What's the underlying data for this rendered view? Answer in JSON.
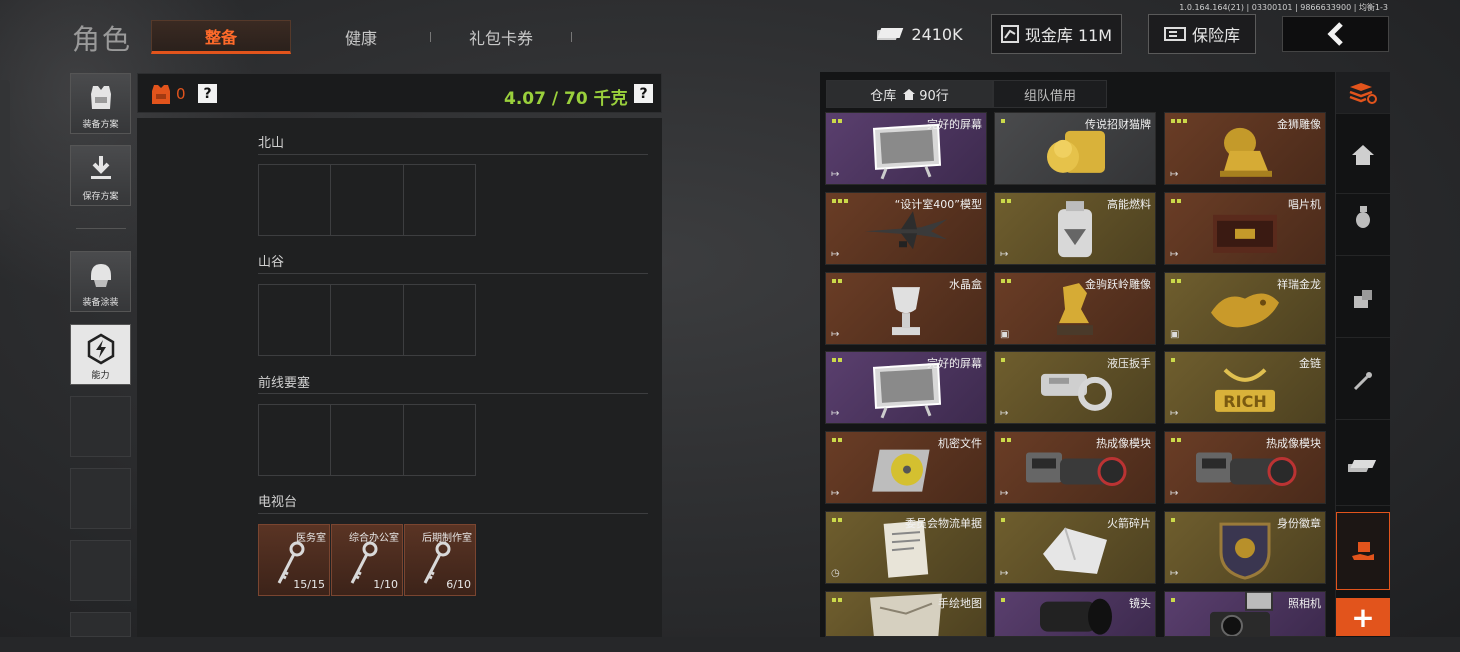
{
  "build_info": "1.0.164.164(21) | 03300101 | 9866633900 | 均衡1-3",
  "header": {
    "title": "角色",
    "tabs": [
      {
        "label": "整备"
      },
      {
        "label": "健康"
      },
      {
        "label": "礼包卡券"
      }
    ],
    "cash": "2410K",
    "cash_vault": "现金库 11M",
    "safe": "保险库"
  },
  "sidebar": {
    "items": [
      {
        "label": "装备方案"
      },
      {
        "label": "保存方案"
      },
      {
        "label": "装备涂装"
      },
      {
        "label": "能力"
      }
    ]
  },
  "loadout": {
    "armor_count": "0",
    "weight": "4.07 / 70 千克"
  },
  "maps": [
    {
      "label": "北山"
    },
    {
      "label": "山谷"
    },
    {
      "label": "前线要塞"
    },
    {
      "label": "电视台"
    }
  ],
  "keys": [
    {
      "name": "医务室",
      "count": "15/15"
    },
    {
      "name": "综合办公室",
      "count": "1/10"
    },
    {
      "name": "后期制作室",
      "count": "6/10"
    }
  ],
  "storage": {
    "tab_warehouse": "仓库",
    "tab_warehouse_count": "90行",
    "tab_team": "组队借用",
    "items": [
      {
        "name": "完好的屏幕",
        "rarity": "purple",
        "dots": 2,
        "corner": "↦",
        "icon": "screen-icon"
      },
      {
        "name": "传说招财猫牌",
        "rarity": "gray",
        "dots": 1,
        "corner": "",
        "icon": "gold-cat-icon"
      },
      {
        "name": "金狮雕像",
        "rarity": "brown",
        "dots": 3,
        "corner": "↦",
        "icon": "lion-statue-icon"
      },
      {
        "name": "“设计室400”模型",
        "rarity": "brown",
        "dots": 3,
        "corner": "↦",
        "icon": "jet-model-icon"
      },
      {
        "name": "高能燃料",
        "rarity": "olive",
        "dots": 2,
        "corner": "↦",
        "icon": "fuel-tank-icon"
      },
      {
        "name": "唱片机",
        "rarity": "brown",
        "dots": 2,
        "corner": "↦",
        "icon": "record-player-icon"
      },
      {
        "name": "水晶盒",
        "rarity": "brown",
        "dots": 2,
        "corner": "↦",
        "icon": "trophy-icon"
      },
      {
        "name": "金驹跃岭雕像",
        "rarity": "brown",
        "dots": 2,
        "corner": "▣",
        "icon": "horse-statue-icon"
      },
      {
        "name": "祥瑞金龙",
        "rarity": "olive",
        "dots": 2,
        "corner": "▣",
        "icon": "dragon-icon"
      },
      {
        "name": "完好的屏幕",
        "rarity": "purple",
        "dots": 2,
        "corner": "↦",
        "icon": "screen-icon"
      },
      {
        "name": "液压扳手",
        "rarity": "olive",
        "dots": 1,
        "corner": "↦",
        "icon": "wrench-icon"
      },
      {
        "name": "金链",
        "rarity": "olive",
        "dots": 1,
        "corner": "↦",
        "icon": "gold-chain-icon"
      },
      {
        "name": "机密文件",
        "rarity": "brown",
        "dots": 2,
        "corner": "↦",
        "icon": "disc-icon"
      },
      {
        "name": "热成像模块",
        "rarity": "brown",
        "dots": 2,
        "corner": "↦",
        "icon": "thermal-module-icon"
      },
      {
        "name": "热成像模块",
        "rarity": "brown",
        "dots": 2,
        "corner": "↦",
        "icon": "thermal-module-icon"
      },
      {
        "name": "委员会物流单据",
        "rarity": "olive",
        "dots": 2,
        "corner": "◷",
        "icon": "document-icon"
      },
      {
        "name": "火箭碎片",
        "rarity": "olive",
        "dots": 1,
        "corner": "↦",
        "icon": "rocket-fragment-icon"
      },
      {
        "name": "身份徽章",
        "rarity": "olive",
        "dots": 1,
        "corner": "↦",
        "icon": "badge-icon"
      },
      {
        "name": "手绘地图",
        "rarity": "olive",
        "dots": 2,
        "corner": "",
        "icon": "map-icon"
      },
      {
        "name": "镜头",
        "rarity": "purple",
        "dots": 1,
        "corner": "",
        "icon": "lens-icon"
      },
      {
        "name": "照相机",
        "rarity": "purple",
        "dots": 1,
        "corner": "",
        "icon": "camera-icon"
      }
    ]
  }
}
